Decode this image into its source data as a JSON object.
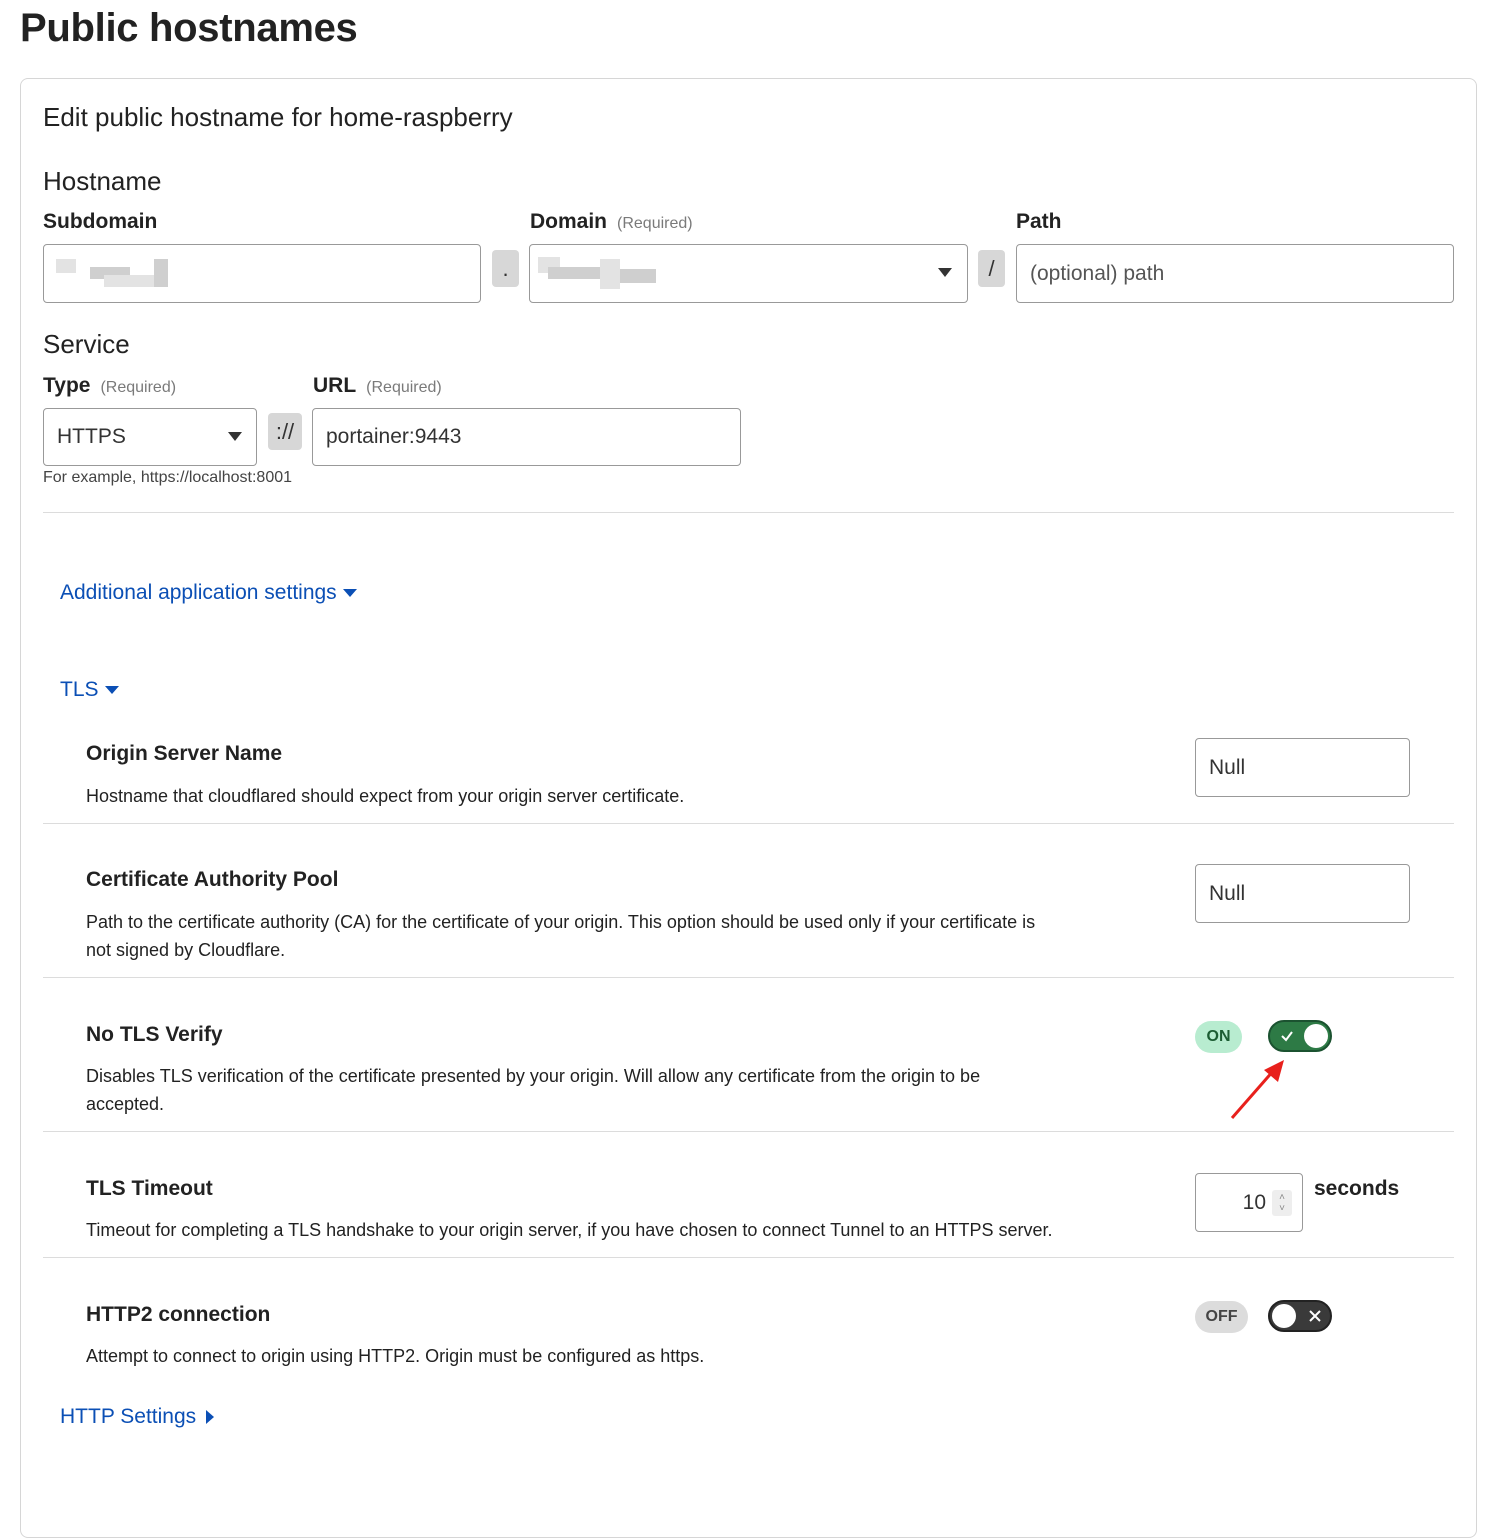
{
  "page_title": "Public hostnames",
  "card_title": "Edit public hostname for home-raspberry",
  "hostname": {
    "section_title": "Hostname",
    "subdomain_label": "Subdomain",
    "domain_label": "Domain",
    "domain_required": "(Required)",
    "path_label": "Path",
    "dot_separator": ".",
    "slash_separator": "/",
    "path_placeholder": "(optional) path"
  },
  "service": {
    "section_title": "Service",
    "type_label": "Type",
    "type_required": "(Required)",
    "url_label": "URL",
    "url_required": "(Required)",
    "type_value": "HTTPS",
    "scheme_separator": "://",
    "url_value": "portainer:9443",
    "hint": "For example, https://localhost:8001"
  },
  "links": {
    "additional": "Additional application settings",
    "tls": "TLS",
    "http_settings": "HTTP Settings"
  },
  "tls_settings": {
    "origin_server_name": {
      "title": "Origin Server Name",
      "desc": "Hostname that cloudflared should expect from your origin server certificate.",
      "value": "Null"
    },
    "ca_pool": {
      "title": "Certificate Authority Pool",
      "desc_line1": "Path to the certificate authority (CA) for the certificate of your origin. This option should be used only if your certificate is",
      "desc_line2": "not signed by Cloudflare.",
      "value": "Null"
    },
    "no_tls_verify": {
      "title": "No TLS Verify",
      "desc_line1": "Disables TLS verification of the certificate presented by your origin. Will allow any certificate from the origin to be",
      "desc_line2": "accepted.",
      "badge": "ON",
      "enabled": true
    },
    "tls_timeout": {
      "title": "TLS Timeout",
      "desc": "Timeout for completing a TLS handshake to your origin server, if you have chosen to connect Tunnel to an HTTPS server.",
      "value": "10",
      "unit": "seconds"
    },
    "http2": {
      "title": "HTTP2 connection",
      "desc": "Attempt to connect to origin using HTTP2. Origin must be configured as https.",
      "badge": "OFF",
      "enabled": false
    }
  },
  "colors": {
    "link": "#0b4fb5",
    "toggle_on": "#2d7a45",
    "badge_on_bg": "#b8ecd0",
    "annotation_arrow": "#e8201c"
  }
}
